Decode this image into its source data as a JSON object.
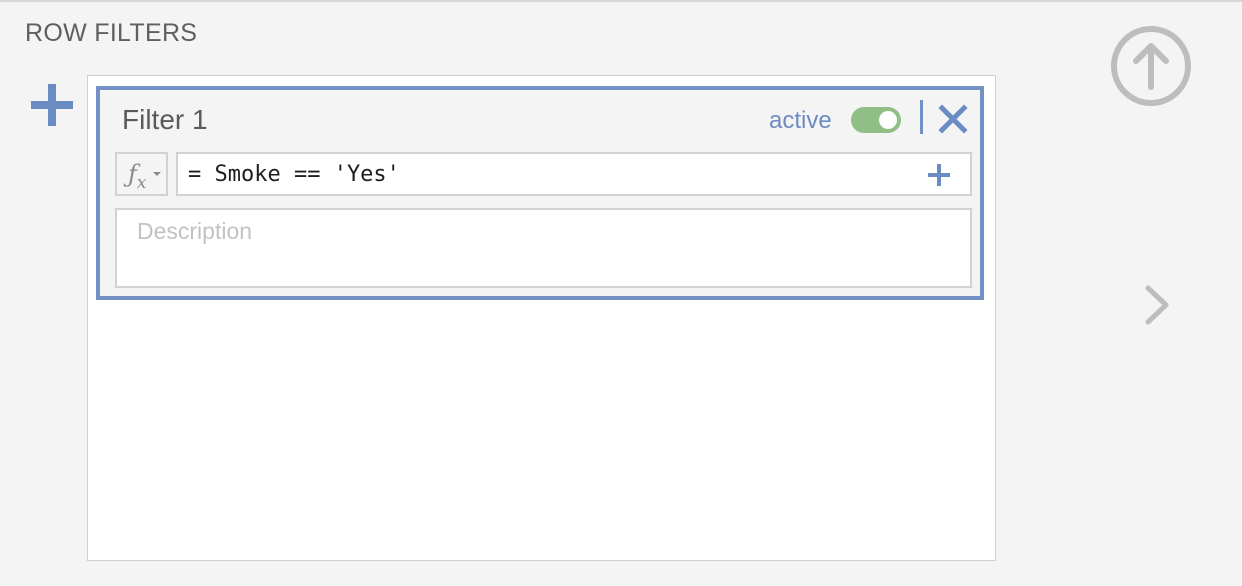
{
  "section": {
    "title": "ROW FILTERS"
  },
  "filter": {
    "name": "Filter 1",
    "status_label": "active",
    "active": true,
    "formula_value": "= Smoke == 'Yes'",
    "formula_icon": "fx",
    "description_placeholder": "Description",
    "description_value": ""
  },
  "icons": {
    "add_filter": "plus-icon",
    "remove_filter": "close-icon",
    "formula_add": "plus-icon",
    "formula_menu": "fx-icon",
    "collapse": "arrow-up-circle-icon",
    "next": "chevron-right-icon"
  },
  "colors": {
    "accent": "#7391c5",
    "toggle_on": "#8fbe87",
    "muted_icon": "#bdbdbd"
  }
}
